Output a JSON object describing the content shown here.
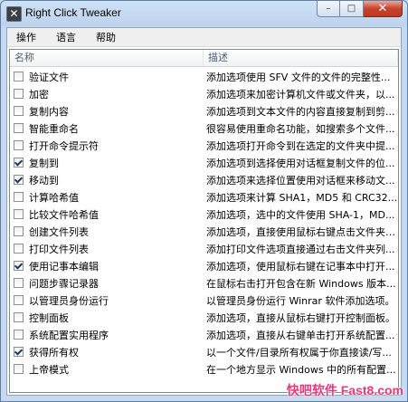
{
  "window": {
    "title": "Right Click Tweaker",
    "app_icon": "x-logo-icon"
  },
  "window_controls": {
    "minimize": "–",
    "maximize": "□",
    "close": "✕"
  },
  "menu": [
    "操作",
    "语言",
    "帮助"
  ],
  "columns": {
    "name": "名称",
    "desc": "描述"
  },
  "rows": [
    {
      "name": "验证文件",
      "checked": false,
      "desc": "添加选项使用 SFV 文件的文件的完整性..."
    },
    {
      "name": "加密",
      "checked": false,
      "desc": "添加选项来加密计算机文件或文件夹，以..."
    },
    {
      "name": "复制内容",
      "checked": false,
      "desc": "添加选项到文本文件的内容直接复制到剪..."
    },
    {
      "name": "智能重命名",
      "checked": false,
      "desc": "很容易使用重命名功能，如搜索多个文件..."
    },
    {
      "name": "打开命令提示符",
      "checked": false,
      "desc": "添加选项打开命令到在选定的文件夹中提..."
    },
    {
      "name": "复制到",
      "checked": true,
      "desc": "添加选项到选择使用对话框复制文件的位..."
    },
    {
      "name": "移动到",
      "checked": true,
      "desc": "添加选项来选择位置使用对话框来移动文..."
    },
    {
      "name": "计算哈希值",
      "checked": false,
      "desc": "添加选项来计算 SHA1，MD5 和 CRC32..."
    },
    {
      "name": "比较文件哈希值",
      "checked": false,
      "desc": "添加选项，选中的文件使用 SHA-1，MD..."
    },
    {
      "name": "创建文件列表",
      "checked": false,
      "desc": "添加选项，直接使用鼠标右键点击文件夹中..."
    },
    {
      "name": "打印文件列表",
      "checked": false,
      "desc": "添加打印文件选项直接通过右击文件夹列..."
    },
    {
      "name": "使用记事本编辑",
      "checked": true,
      "desc": "添加选项，使用鼠标右键在记事本中打开..."
    },
    {
      "name": "问题步骤记录器",
      "checked": false,
      "desc": "在鼠标右击打开包含在新 Windows 版本..."
    },
    {
      "name": "以管理员身份运行",
      "checked": false,
      "desc": "以管理员身份运行 Winrar 软件添加选项。"
    },
    {
      "name": "控制面板",
      "checked": false,
      "desc": "添加选项，直接从鼠标右键打开控制面板。"
    },
    {
      "name": "系统配置实用程序",
      "checked": false,
      "desc": "添加选项，直接从右键单击打开系统配置..."
    },
    {
      "name": "获得所有权",
      "checked": true,
      "desc": "以一个文件/目录所有权属于你直接读/写..."
    },
    {
      "name": "上帝模式",
      "checked": false,
      "desc": "在一个地方显示 Windows 中的所有配置..."
    }
  ],
  "watermark": "快吧软件 Fast8.com"
}
